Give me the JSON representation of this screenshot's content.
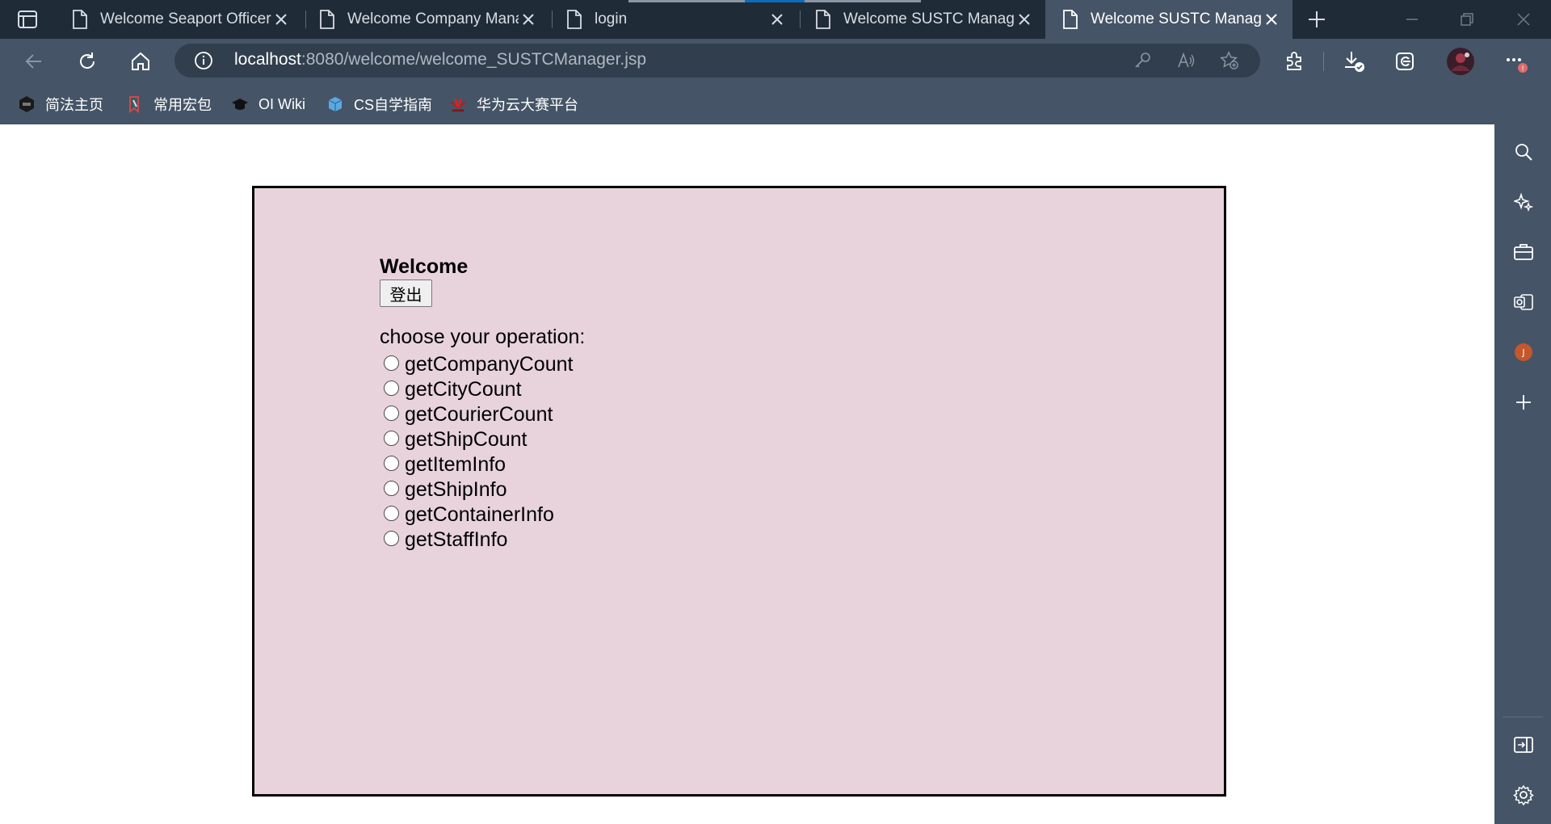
{
  "browser": {
    "tabs": [
      {
        "title": "Welcome Seaport Officer",
        "active": false
      },
      {
        "title": "Welcome Company Manager",
        "active": false
      },
      {
        "title": "login",
        "active": false
      },
      {
        "title": "Welcome SUSTC Manager",
        "active": false
      },
      {
        "title": "Welcome SUSTC Manager",
        "active": true
      }
    ],
    "address": {
      "host": "localhost",
      "rest": ":8080/welcome/welcome_SUSTCManager.jsp"
    },
    "favorites": [
      {
        "label": "简法主页",
        "icon": "dark-circle-icon"
      },
      {
        "label": "常用宏包",
        "icon": "bookmark-red-icon"
      },
      {
        "label": "OI Wiki",
        "icon": "graduation-cap-icon"
      },
      {
        "label": "CS自学指南",
        "icon": "cube-icon"
      },
      {
        "label": "华为云大赛平台",
        "icon": "huawei-icon"
      }
    ],
    "profile_badge": "J",
    "colors": {
      "tabbar": "#202b38",
      "toolbar": "#455466",
      "accent": "#0f6cbd"
    }
  },
  "page": {
    "welcome": "Welcome",
    "logout_label": "登出",
    "choose_label": "choose your operation:",
    "operations": [
      "getCompanyCount",
      "getCityCount",
      "getCourierCount",
      "getShipCount",
      "getItemInfo",
      "getShipInfo",
      "getContainerInfo",
      "getStaffInfo"
    ],
    "background": "#e8d3dc"
  }
}
